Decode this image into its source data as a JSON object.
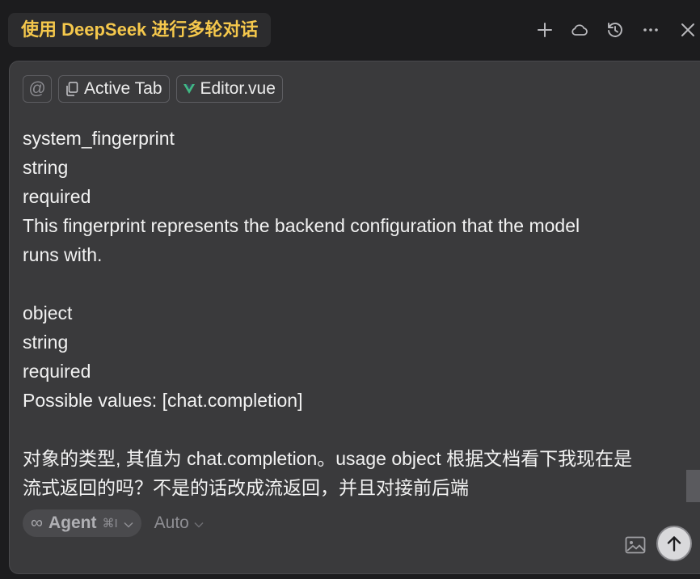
{
  "header": {
    "title": "使用 DeepSeek 进行多轮对话",
    "icons": [
      "plus-icon",
      "cloud-icon",
      "history-icon",
      "more-icon",
      "close-icon"
    ]
  },
  "context_chips": {
    "at_symbol": "@",
    "active_tab": "Active Tab",
    "file": "Editor.vue"
  },
  "message_lines": [
    "system_fingerprint",
    "string",
    "required",
    "This fingerprint represents the backend configuration that the model",
    "runs with.",
    "",
    "object",
    "string",
    "required",
    "Possible values: [chat.completion]",
    "",
    "对象的类型, 其值为 chat.completion。usage object 根据文档看下我现在是",
    "流式返回的吗？不是的话改成流返回，并且对接前后端"
  ],
  "footer": {
    "agent_symbol": "∞",
    "agent_label": "Agent",
    "agent_shortcut": "⌘I",
    "model_label": "Auto"
  },
  "colors": {
    "title_text": "#f5c84c",
    "vue_icon": "#41b883",
    "composer_bg": "#3a3a3c",
    "app_bg": "#1c1c1e"
  }
}
